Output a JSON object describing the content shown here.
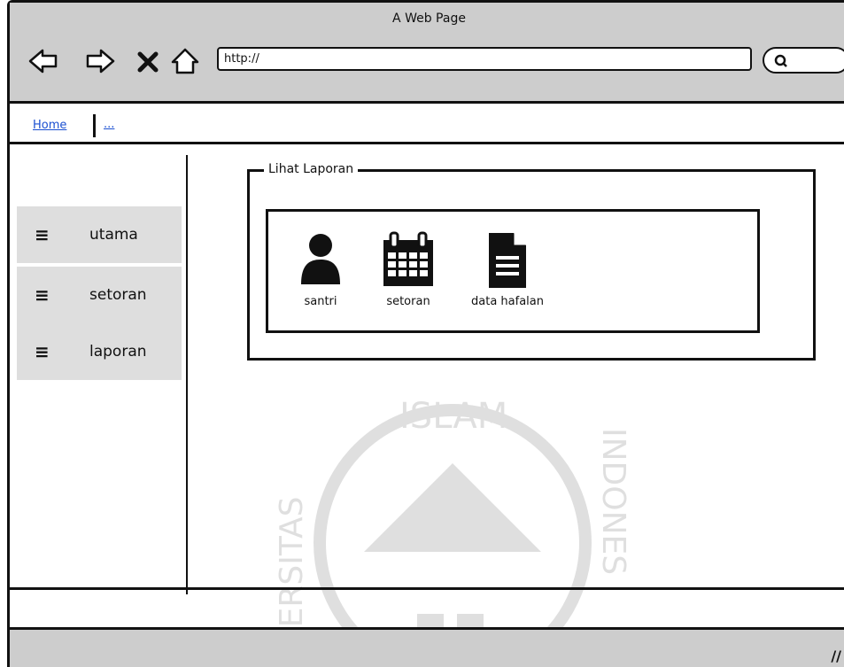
{
  "window": {
    "title": "A Web Page"
  },
  "toolbar": {
    "back_icon": "back-arrow-icon",
    "forward_icon": "forward-arrow-icon",
    "stop_icon": "close-icon",
    "home_icon": "home-icon"
  },
  "address_bar": {
    "value": "http://"
  },
  "search": {
    "icon": "search-icon"
  },
  "tabs": [
    {
      "label": "Home"
    },
    {
      "label": "..."
    }
  ],
  "sidebar": {
    "items": [
      {
        "label": "utama",
        "icon": "menu-icon"
      },
      {
        "label": "setoran",
        "icon": "menu-icon"
      },
      {
        "label": "laporan",
        "icon": "menu-icon"
      }
    ]
  },
  "main": {
    "group_title": "Lihat Laporan",
    "tiles": [
      {
        "label": "santri",
        "icon": "user-icon"
      },
      {
        "label": "setoran",
        "icon": "calendar-icon"
      },
      {
        "label": "data hafalan",
        "icon": "document-icon"
      }
    ]
  },
  "watermark": {
    "text_top": "ISLAM",
    "text_left": "VERSITAS",
    "text_right": "INDONES"
  }
}
